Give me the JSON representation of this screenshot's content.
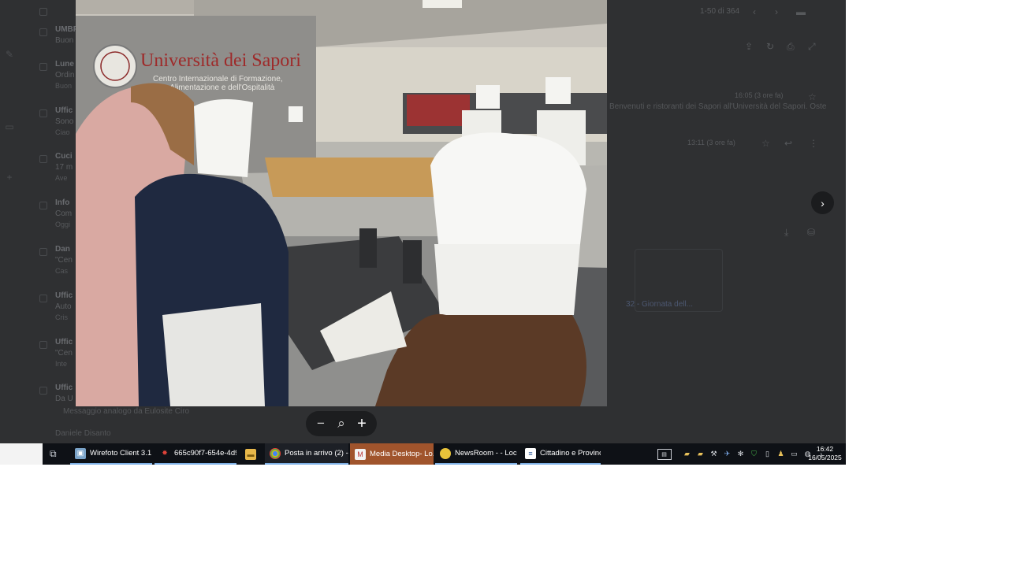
{
  "gmail": {
    "page_count": "1-50 di 364",
    "rows": [
      {
        "line1": "UMBR",
        "line2": "Buon",
        "line3": ""
      },
      {
        "line1": "Lune",
        "line2": "Ordin",
        "line3": "Buon"
      },
      {
        "line1": "Uffic",
        "line2": "Sono",
        "line3": "Ciao"
      },
      {
        "line1": "Cuci",
        "line2": "17 m",
        "line3": "Ave"
      },
      {
        "line1": "Info",
        "line2": "Com",
        "line3": "Oggi"
      },
      {
        "line1": "Dan",
        "line2": "\"Cen",
        "line3": "Cas"
      },
      {
        "line1": "Uffic",
        "line2": "Auto",
        "line3": "Cris"
      },
      {
        "line1": "Uffic",
        "line2": "\"Cen",
        "line3": "Inte"
      },
      {
        "line1": "Uffic",
        "line2": "Da U",
        "line3": ""
      }
    ],
    "snippet": "Benvenuti e ristoranti dei Sapori all'Università del Sapori. Oste",
    "time_1": "16:05 (3 ore fa)",
    "time_2": "13:11 (3 ore fa)",
    "attachment_label": "32 - Giornata dell...",
    "footer_text": "Messaggio analogo da Eulosite Ciro",
    "footer_sender": "Daniele Disanto"
  },
  "photo": {
    "alt": "Università dei Sapori",
    "wall_sign_title": "Università dei Sapori",
    "wall_sign_line1": "Centro Internazionale di Formazione,",
    "wall_sign_line2": "Cultura, Alimentazione e dell'Ospitalità"
  },
  "viewer": {
    "zoom_out": "−",
    "zoom_icon": "⌕",
    "zoom_in": "+",
    "next": "›"
  },
  "taskbar": {
    "items": [
      {
        "label": "Wirefoto Client 3.1...",
        "icon": "photo-app-icon"
      },
      {
        "label": "665c90f7-654e-4d9...",
        "icon": "document-icon"
      },
      {
        "label": "",
        "icon": "file-explorer-icon"
      },
      {
        "label": "Posta in arrivo (2) - ...",
        "icon": "chrome-icon"
      },
      {
        "label": "Media Desktop- Lo...",
        "icon": "media-desktop-icon"
      },
      {
        "label": "NewsRoom - - Loc...",
        "icon": "newsroom-icon"
      },
      {
        "label": "Cittadino e Provinc...",
        "icon": "word-doc-icon"
      }
    ],
    "time": "16:42",
    "date": "16/05/2025"
  },
  "colors": {
    "taskbar": "#0e1116",
    "active_task": "#a0542c",
    "overlay": "#2f3032"
  }
}
